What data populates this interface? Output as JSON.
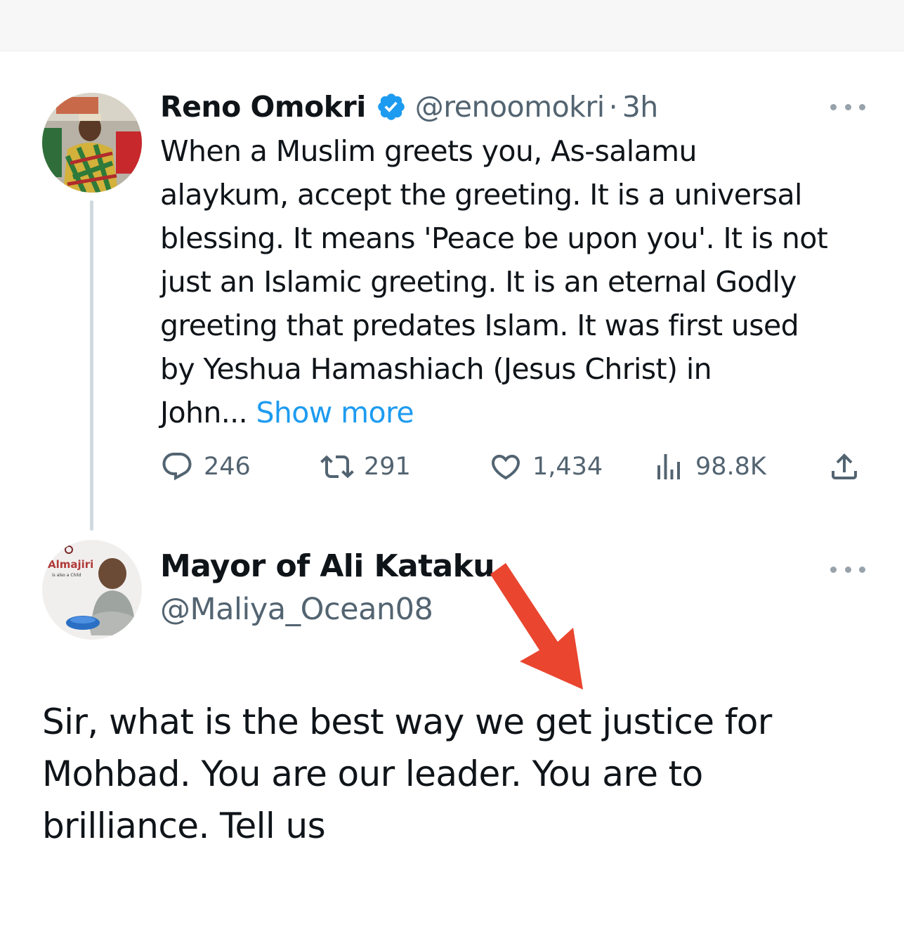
{
  "tweet": {
    "author_name": "Reno Omokri",
    "handle": "@renoomokri",
    "separator": "·",
    "time": "3h",
    "body_lines": [
      "When a Muslim greets you, As-salamu",
      "alaykum, accept the greeting. It is a universal",
      "blessing. It means 'Peace be upon you'. It is not",
      "just an Islamic greeting. It is an eternal Godly",
      "greeting that predates Islam. It was first used",
      "by Yeshua Hamashiach (Jesus Christ) in"
    ],
    "body_last_line": "John... ",
    "show_more": "Show more",
    "stats": {
      "replies": "246",
      "retweets": "291",
      "likes": "1,434",
      "views": "98.8K"
    },
    "icons": [
      "verified-badge-icon",
      "more-icon",
      "reply-icon",
      "retweet-icon",
      "like-icon",
      "views-icon",
      "share-icon"
    ]
  },
  "reply": {
    "author_name": "Mayor of Ali Kataku",
    "handle": "@Maliya_Ocean08",
    "avatar_text": "Almajiri",
    "avatar_subtext": "is also a Child",
    "body_lines": [
      "Sir, what is the best way we get justice for",
      "Mohbad. You are our leader. You are to",
      "brilliance. Tell us"
    ]
  },
  "colors": {
    "accent": "#1d9bf0",
    "text": "#0f1419",
    "muted": "#536471",
    "annotation_arrow": "#e9452f"
  }
}
